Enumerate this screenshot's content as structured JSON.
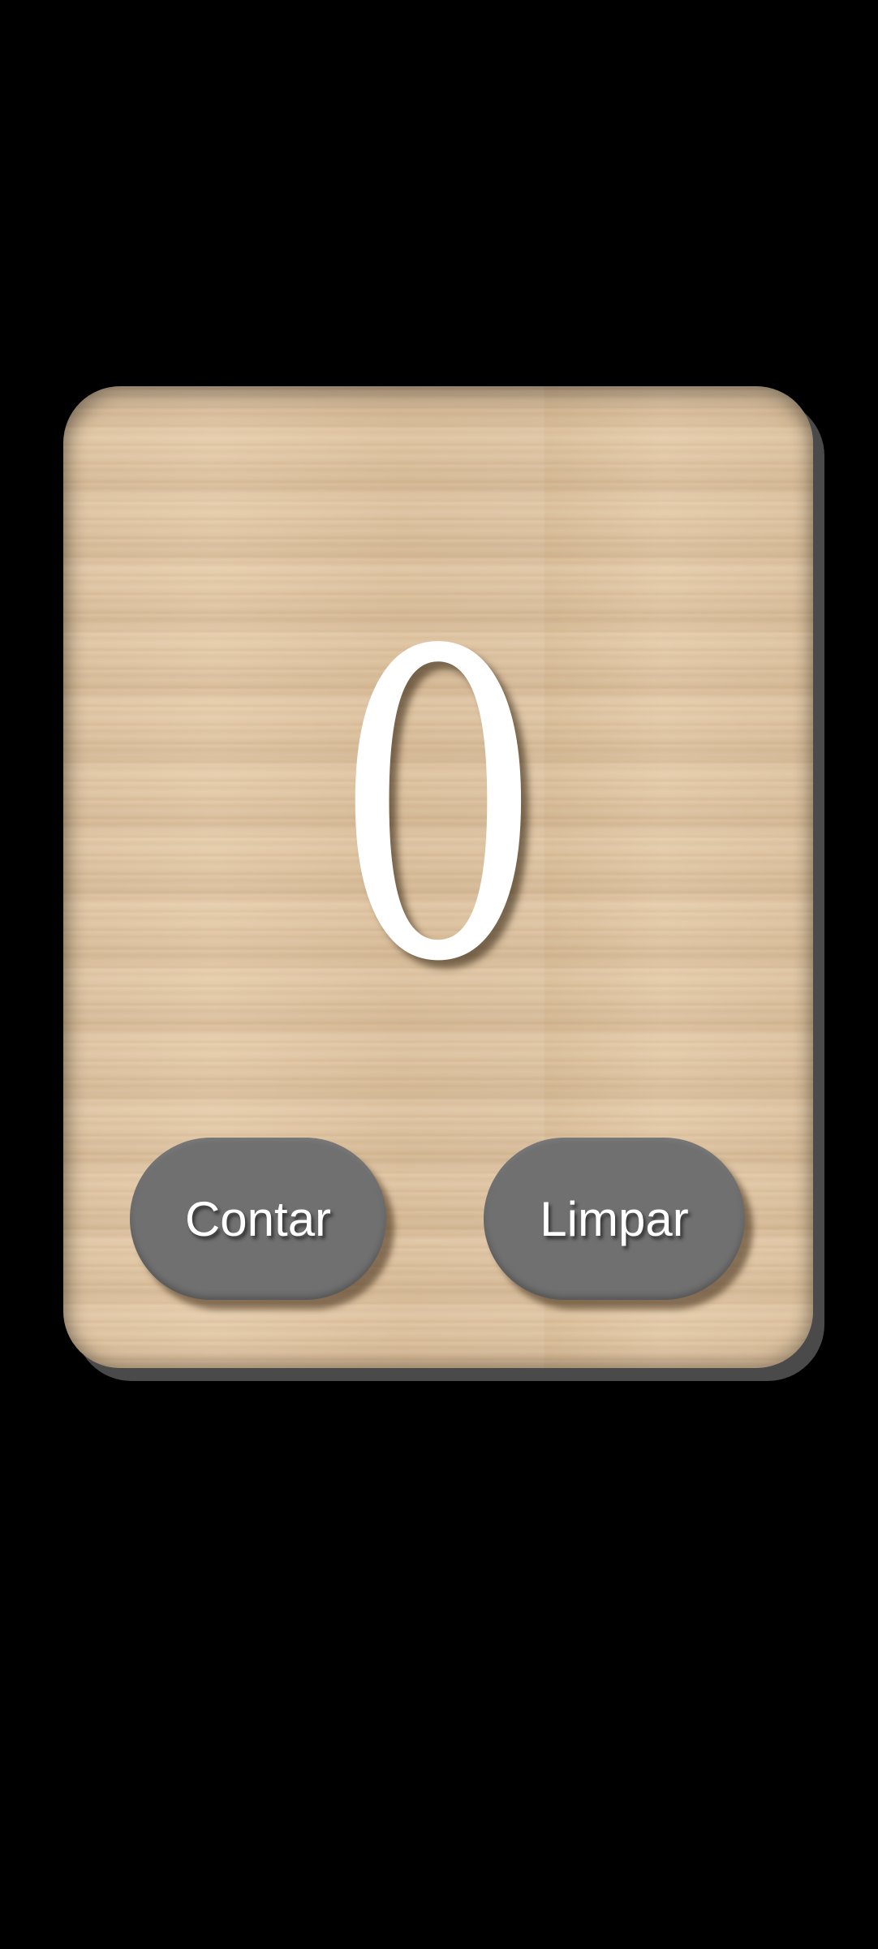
{
  "counter": {
    "value": "0"
  },
  "buttons": {
    "count_label": "Contar",
    "clear_label": "Limpar"
  },
  "colors": {
    "background": "#000000",
    "button": "#707070",
    "counter_text": "#ffffff",
    "card_wood": "#e0c6a4"
  }
}
